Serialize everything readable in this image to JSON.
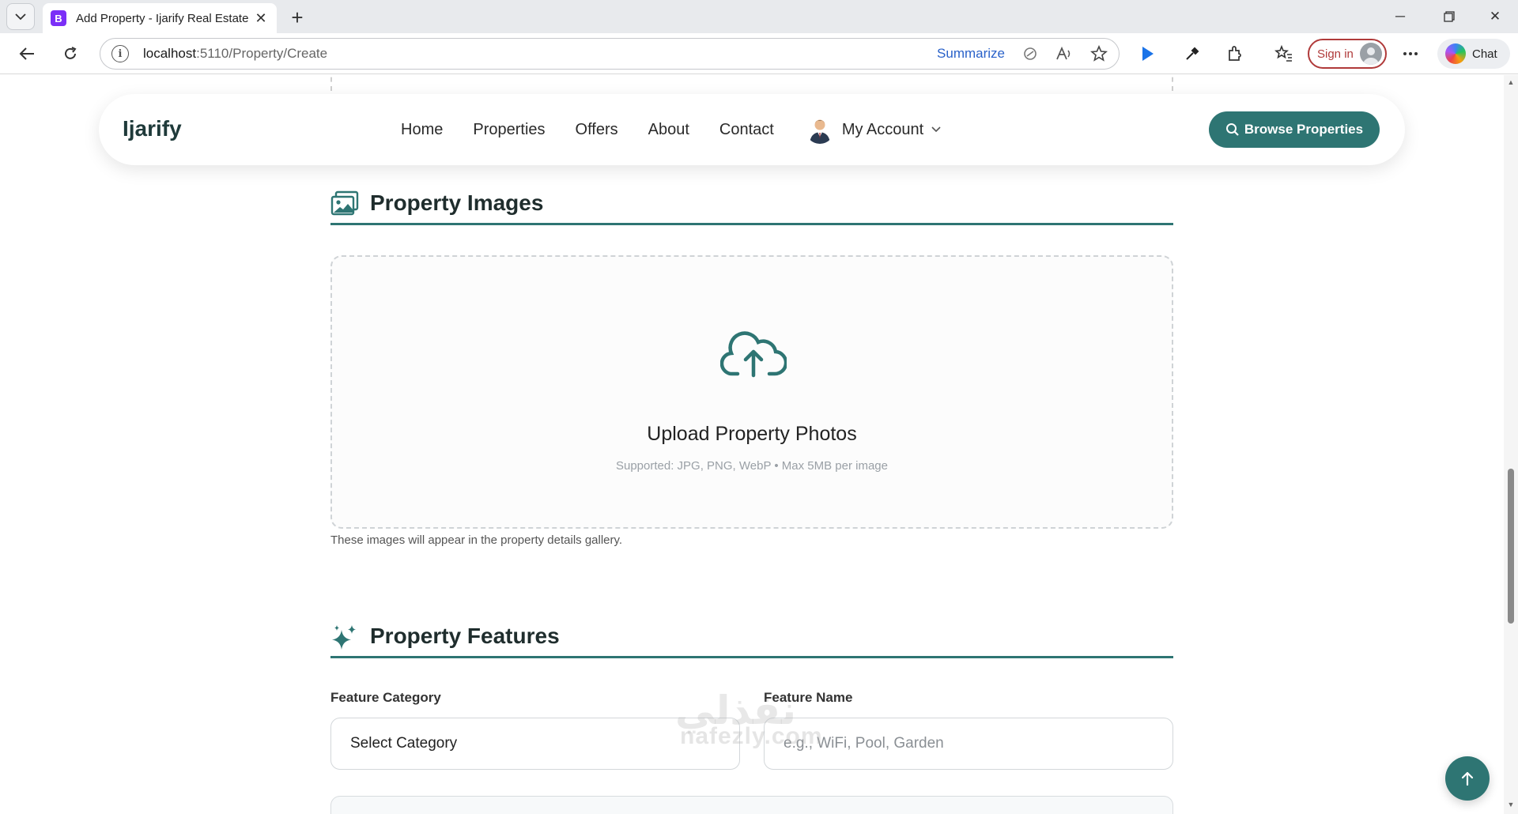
{
  "browser": {
    "tab_title": "Add Property - Ijarify Real Estate",
    "tab_favicon": "B",
    "url_host": "localhost",
    "url_path": ":5110/Property/Create",
    "summarize_label": "Summarize",
    "signin_label": "Sign in",
    "chat_label": "Chat"
  },
  "navbar": {
    "brand": "Ijarify",
    "links": [
      "Home",
      "Properties",
      "Offers",
      "About",
      "Contact"
    ],
    "account_label": "My Account",
    "browse_button": "Browse Properties"
  },
  "images_section": {
    "title": "Property Images",
    "upload_title": "Upload Property Photos",
    "upload_hint": "Supported: JPG, PNG, WebP • Max 5MB per image",
    "gallery_note": "These images will appear in the property details gallery."
  },
  "features_section": {
    "title": "Property Features",
    "category_label": "Feature Category",
    "category_value": "Select Category",
    "name_label": "Feature Name",
    "name_placeholder": "e.g., WiFi, Pool, Garden"
  },
  "watermark": {
    "text": "nafezly.com",
    "arabic": "نفذلي"
  },
  "colors": {
    "brand_teal": "#2e7573",
    "signin_red": "#b03a3a"
  }
}
